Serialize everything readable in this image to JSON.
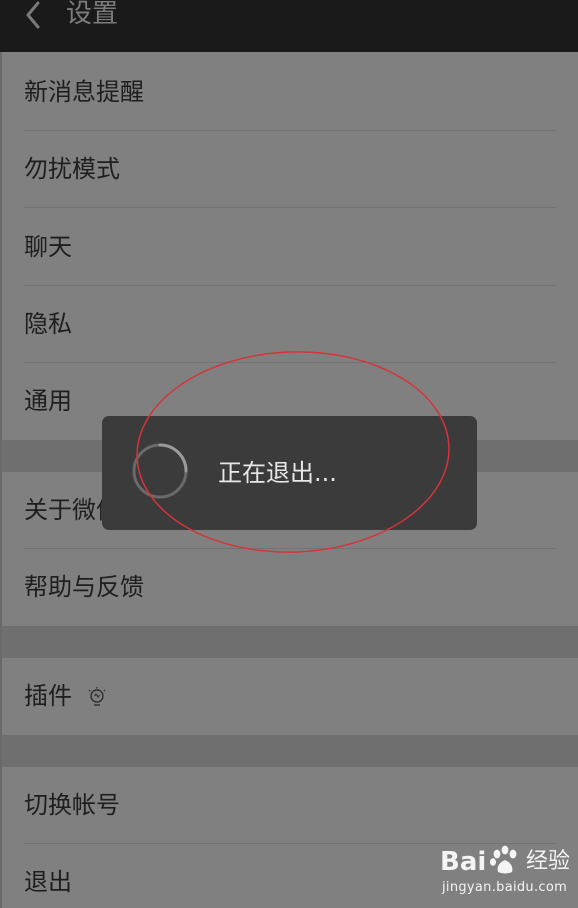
{
  "header": {
    "title": "设置"
  },
  "menu": {
    "group1": [
      "新消息提醒",
      "勿扰模式",
      "聊天",
      "隐私",
      "通用"
    ],
    "group2": [
      "关于微信",
      "帮助与反馈"
    ],
    "group3": [
      "插件"
    ],
    "group4": [
      "切换帐号",
      "退出"
    ]
  },
  "toast": {
    "message": "正在退出..."
  },
  "watermark": {
    "brand_latin": "Bai",
    "brand_cn": "经验",
    "url": "jingyan.baidu.com"
  },
  "colors": {
    "annotation_circle": "#d4343a",
    "toast_background": "#3b3b3b",
    "titlebar_background": "#1a1a1a"
  },
  "icons": {
    "back": "chevron-left-icon",
    "plugin_badge": "lightbulb-icon",
    "loading": "spinner-icon"
  }
}
